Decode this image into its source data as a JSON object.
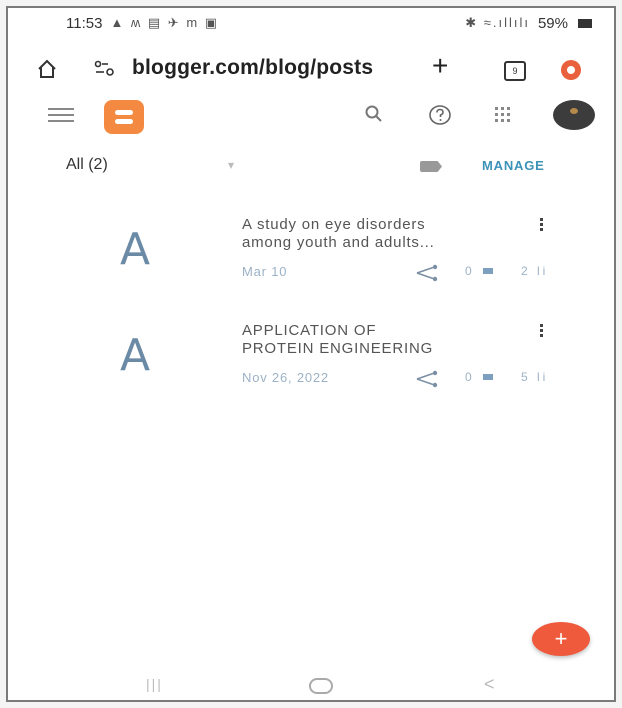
{
  "status_bar": {
    "time": "11:53",
    "notification_icons": "▲ ʍ ▤ ✈ m ▣",
    "signal_text": "✱ ≈.ıllılı",
    "battery_percent": "59%"
  },
  "browser": {
    "url": "blogger.com/blog/posts",
    "new_tab_label": "+",
    "tabs_count": "9"
  },
  "header": {
    "icons": [
      "menu-icon",
      "blogger-logo",
      "search-icon",
      "help-icon",
      "apps-icon",
      "avatar"
    ]
  },
  "filter": {
    "label": "All (2)",
    "dropdown_glyph": "▾",
    "manage_label": "MANAGE"
  },
  "posts": [
    {
      "thumb_letter": "A",
      "title": "A study on eye disorders\namong youth and adults...",
      "date": "Mar 10",
      "comments": "0",
      "views": "2 li"
    },
    {
      "thumb_letter": "A",
      "title": "APPLICATION OF\nPROTEIN ENGINEERING",
      "date": "Nov 26, 2022",
      "comments": "0",
      "views": "5 li"
    }
  ],
  "fab": {
    "label": "+"
  },
  "nav": {
    "recents_glyph": "|||",
    "back_glyph": "<"
  },
  "colors": {
    "accent": "#3d92b8",
    "blogger_orange": "#f48a42",
    "fab": "#ef5a3c"
  }
}
